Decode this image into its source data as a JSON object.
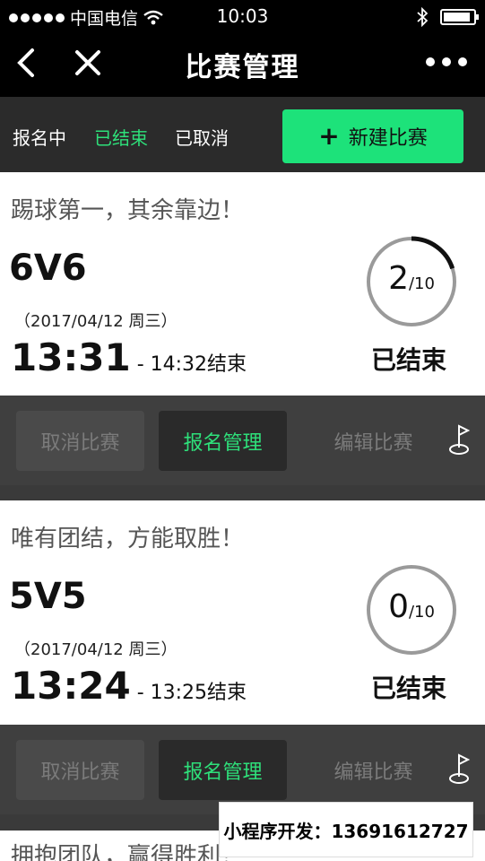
{
  "status_bar": {
    "carrier": "中国电信",
    "time": "10:03",
    "battery_level": 0.9
  },
  "nav": {
    "title": "比赛管理"
  },
  "tabs": [
    {
      "label": "报名中",
      "active": false
    },
    {
      "label": "已结束",
      "active": true
    },
    {
      "label": "已取消",
      "active": false
    }
  ],
  "new_match_button": {
    "label": "新建比赛"
  },
  "colors": {
    "accent": "#1de27a",
    "accent_text": "#2ee07a",
    "nav_bg": "#000000",
    "tab_bg": "#2b2b2b",
    "action_bg": "#3f3f3f",
    "ring_track": "#9a9a9a",
    "ring_progress": "#111111"
  },
  "matches": [
    {
      "slogan": "踢球第一，其余靠边！",
      "format": "6V6",
      "date": "（2017/04/12 周三）",
      "start_time": "13:31",
      "end_time": " - 14:32结束",
      "registered": "2",
      "capacity": "/10",
      "registered_fraction": 0.2,
      "status": "已结束",
      "actions": {
        "cancel": "取消比赛",
        "signup": "报名管理",
        "edit": "编辑比赛"
      }
    },
    {
      "slogan": "唯有团结，方能取胜！",
      "format": "5V5",
      "date": "（2017/04/12 周三）",
      "start_time": "13:24",
      "end_time": " - 13:25结束",
      "registered": "0",
      "capacity": "/10",
      "registered_fraction": 0.0,
      "status": "已结束",
      "actions": {
        "cancel": "取消比赛",
        "signup": "报名管理",
        "edit": "编辑比赛"
      }
    },
    {
      "slogan": "拥抱团队，赢得胜利！"
    }
  ],
  "promo": {
    "text": "小程序开发：13691612727"
  },
  "icons": [
    "back-icon",
    "close-icon",
    "more-icon",
    "plus-icon",
    "golf-flag-icon",
    "wifi-icon",
    "bluetooth-icon",
    "battery-icon"
  ]
}
